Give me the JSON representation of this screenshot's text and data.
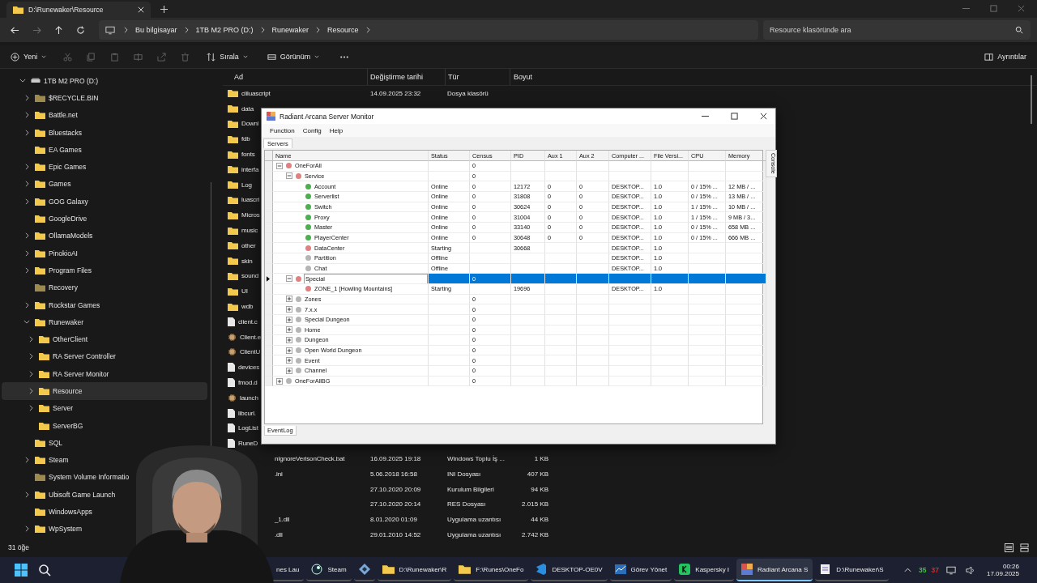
{
  "explorer": {
    "tab_title": "D:\\Runewaker\\Resource",
    "breadcrumb": [
      "Bu bilgisayar",
      "1TB M2 PRO (D:)",
      "Runewaker",
      "Resource"
    ],
    "search": {
      "placeholder": "Resource klasöründe ara"
    },
    "toolbar": {
      "new": "Yeni",
      "sort": "Sırala",
      "view": "Görünüm",
      "details": "Ayrıntılar"
    },
    "status": "31 öğe"
  },
  "sidebar": {
    "items": [
      {
        "label": "1TB M2 PRO (D:)",
        "kind": "drive",
        "expandable": true,
        "expanded": true,
        "hidden": false,
        "selected": false,
        "children": [
          {
            "label": "$RECYCLE.BIN",
            "kind": "folder",
            "expandable": true,
            "expanded": false,
            "hidden": true,
            "selected": false
          },
          {
            "label": "Battle.net",
            "kind": "folder",
            "expandable": true,
            "expanded": false,
            "hidden": false,
            "selected": false
          },
          {
            "label": "Bluestacks",
            "kind": "folder",
            "expandable": true,
            "expanded": false,
            "hidden": false,
            "selected": false
          },
          {
            "label": "EA Games",
            "kind": "folder",
            "expandable": false,
            "expanded": false,
            "hidden": false,
            "selected": false
          },
          {
            "label": "Epic Games",
            "kind": "folder",
            "expandable": true,
            "expanded": false,
            "hidden": false,
            "selected": false
          },
          {
            "label": "Games",
            "kind": "folder",
            "expandable": true,
            "expanded": false,
            "hidden": false,
            "selected": false
          },
          {
            "label": "GOG Galaxy",
            "kind": "folder",
            "expandable": true,
            "expanded": false,
            "hidden": false,
            "selected": false
          },
          {
            "label": "GoogleDrive",
            "kind": "folder",
            "expandable": false,
            "expanded": false,
            "hidden": false,
            "selected": false
          },
          {
            "label": "OllamaModels",
            "kind": "folder",
            "expandable": true,
            "expanded": false,
            "hidden": false,
            "selected": false
          },
          {
            "label": "PinokioAI",
            "kind": "folder",
            "expandable": true,
            "expanded": false,
            "hidden": false,
            "selected": false
          },
          {
            "label": "Program Files",
            "kind": "folder",
            "expandable": true,
            "expanded": false,
            "hidden": false,
            "selected": false
          },
          {
            "label": "Recovery",
            "kind": "folder",
            "expandable": false,
            "expanded": false,
            "hidden": true,
            "selected": false
          },
          {
            "label": "Rockstar Games",
            "kind": "folder",
            "expandable": true,
            "expanded": false,
            "hidden": false,
            "selected": false
          },
          {
            "label": "Runewaker",
            "kind": "folder",
            "expandable": true,
            "expanded": true,
            "hidden": false,
            "selected": false,
            "children": [
              {
                "label": "OtherClient",
                "kind": "folder",
                "expandable": true,
                "expanded": false,
                "hidden": false,
                "selected": false
              },
              {
                "label": "RA Server Controller",
                "kind": "folder",
                "expandable": true,
                "expanded": false,
                "hidden": false,
                "selected": false
              },
              {
                "label": "RA Server Monitor",
                "kind": "folder",
                "expandable": true,
                "expanded": false,
                "hidden": false,
                "selected": false
              },
              {
                "label": "Resource",
                "kind": "folder",
                "expandable": true,
                "expanded": false,
                "hidden": false,
                "selected": true
              },
              {
                "label": "Server",
                "kind": "folder",
                "expandable": true,
                "expanded": false,
                "hidden": false,
                "selected": false
              },
              {
                "label": "ServerBG",
                "kind": "folder",
                "expandable": false,
                "expanded": false,
                "hidden": false,
                "selected": false
              }
            ]
          },
          {
            "label": "SQL",
            "kind": "folder",
            "expandable": false,
            "expanded": false,
            "hidden": false,
            "selected": false
          },
          {
            "label": "Steam",
            "kind": "folder",
            "expandable": true,
            "expanded": false,
            "hidden": false,
            "selected": false
          },
          {
            "label": "System Volume Informatio",
            "kind": "folder",
            "expandable": false,
            "expanded": false,
            "hidden": true,
            "selected": false
          },
          {
            "label": "Ubisoft Game Launch",
            "kind": "folder",
            "expandable": true,
            "expanded": false,
            "hidden": false,
            "selected": false
          },
          {
            "label": "WindowsApps",
            "kind": "folder",
            "expandable": false,
            "expanded": false,
            "hidden": false,
            "selected": false
          },
          {
            "label": "WpSystem",
            "kind": "folder",
            "expandable": true,
            "expanded": false,
            "hidden": false,
            "selected": false
          }
        ]
      }
    ]
  },
  "files": {
    "columns": [
      "Ad",
      "Değiştirme tarihi",
      "Tür",
      "Boyut"
    ],
    "rows": [
      {
        "kind": "folder",
        "name": "cliluascript",
        "modified": "14.09.2025 23:32",
        "type": "Dosya klasörü"
      },
      {
        "kind": "folder",
        "name": "data"
      },
      {
        "kind": "folder",
        "name": "Downl"
      },
      {
        "kind": "folder",
        "name": "fdb"
      },
      {
        "kind": "folder",
        "name": "fonts"
      },
      {
        "kind": "folder",
        "name": "interfa"
      },
      {
        "kind": "folder",
        "name": "Log"
      },
      {
        "kind": "folder",
        "name": "luascri"
      },
      {
        "kind": "folder",
        "name": "Micros"
      },
      {
        "kind": "folder",
        "name": "music"
      },
      {
        "kind": "folder",
        "name": "other"
      },
      {
        "kind": "folder",
        "name": "skin"
      },
      {
        "kind": "folder",
        "name": "sound"
      },
      {
        "kind": "folder",
        "name": "UI"
      },
      {
        "kind": "folder",
        "name": "wdb"
      },
      {
        "kind": "file",
        "name": "client.c"
      },
      {
        "kind": "app",
        "name": "Client.e"
      },
      {
        "kind": "app",
        "name": "ClientU"
      },
      {
        "kind": "file",
        "name": "devices"
      },
      {
        "kind": "file",
        "name": "fmod.d"
      },
      {
        "kind": "app",
        "name": "launch"
      },
      {
        "kind": "file",
        "name": "libcurl."
      },
      {
        "kind": "file",
        "name": "LogList"
      },
      {
        "kind": "file",
        "name": "RuneD"
      },
      {
        "kind": "blank",
        "name": "nIgnoreVerisonCheck.bat",
        "modified": "16.09.2025 19:18",
        "type": "Windows Toplu İş ...",
        "size": "1 KB"
      },
      {
        "kind": "blank",
        "name": ".ini",
        "modified": "5.06.2018 16:58",
        "type": "INI Dosyası",
        "size": "407 KB"
      },
      {
        "kind": "blank",
        "modified": "27.10.2020 20:09",
        "type": "Kurulum Bilgileri",
        "size": "94 KB"
      },
      {
        "kind": "blank",
        "modified": "27.10.2020 20:14",
        "type": "RES Dosyası",
        "size": "2.015 KB"
      },
      {
        "kind": "blank",
        "name": "_1.dll",
        "modified": "8.01.2020 01:09",
        "type": "Uygulama uzantısı",
        "size": "44 KB"
      },
      {
        "kind": "blank",
        "name": ".dll",
        "modified": "29.01.2010 14:52",
        "type": "Uygulama uzantısı",
        "size": "2.742 KB"
      }
    ]
  },
  "monitor": {
    "title": "Radiant Arcana Server Monitor",
    "menu": [
      "Function",
      "Config",
      "Help"
    ],
    "tabs": [
      {
        "label": "Servers",
        "selected": true
      }
    ],
    "side_tab": "Console",
    "bottom_tab": "EventLog",
    "columns": [
      "Name",
      "Status",
      "Census",
      "PID",
      "Aux 1",
      "Aux 2",
      "Computer ...",
      "File Versi...",
      "CPU",
      "Memory"
    ],
    "rows": [
      {
        "name": "OneForAll",
        "color": "#e08080",
        "census": "0",
        "expanded": true,
        "selected": false,
        "children": [
          {
            "name": "Service",
            "color": "#e08080",
            "census": "0",
            "expanded": true,
            "selected": false,
            "children": [
              {
                "name": "Account",
                "color": "#4caf50",
                "status": "Online",
                "census": "0",
                "pid": "12172",
                "aux1": "0",
                "aux2": "0",
                "computer": "DESKTOP...",
                "file_version": "1.0",
                "cpu": "0 / 15% ...",
                "memory": "12 MB / ...",
                "selected": false
              },
              {
                "name": "Serverlist",
                "color": "#4caf50",
                "status": "Online",
                "census": "0",
                "pid": "31808",
                "aux1": "0",
                "aux2": "0",
                "computer": "DESKTOP...",
                "file_version": "1.0",
                "cpu": "0 / 15% ...",
                "memory": "13 MB / ...",
                "selected": false
              },
              {
                "name": "Switch",
                "color": "#4caf50",
                "status": "Online",
                "census": "0",
                "pid": "30624",
                "aux1": "0",
                "aux2": "0",
                "computer": "DESKTOP...",
                "file_version": "1.0",
                "cpu": "1 / 15% ...",
                "memory": "10 MB / ...",
                "selected": false
              },
              {
                "name": "Proxy",
                "color": "#4caf50",
                "status": "Online",
                "census": "0",
                "pid": "31004",
                "aux1": "0",
                "aux2": "0",
                "computer": "DESKTOP...",
                "file_version": "1.0",
                "cpu": "1 / 15% ...",
                "memory": "9 MB / 3...",
                "selected": false
              },
              {
                "name": "Master",
                "color": "#4caf50",
                "status": "Online",
                "census": "0",
                "pid": "33140",
                "aux1": "0",
                "aux2": "0",
                "computer": "DESKTOP...",
                "file_version": "1.0",
                "cpu": "0 / 15% ...",
                "memory": "658 MB ...",
                "selected": false
              },
              {
                "name": "PlayerCenter",
                "color": "#4caf50",
                "status": "Online",
                "census": "0",
                "pid": "30648",
                "aux1": "0",
                "aux2": "0",
                "computer": "DESKTOP...",
                "file_version": "1.0",
                "cpu": "0 / 15% ...",
                "memory": "666 MB ...",
                "selected": false
              },
              {
                "name": "DataCenter",
                "color": "#e08080",
                "status": "Starting",
                "pid": "30668",
                "computer": "DESKTOP...",
                "file_version": "1.0",
                "selected": false
              },
              {
                "name": "Partition",
                "color": "#b5b5b5",
                "status": "Offline",
                "computer": "DESKTOP...",
                "file_version": "1.0",
                "selected": false
              },
              {
                "name": "Chat",
                "color": "#b5b5b5",
                "status": "Offline",
                "computer": "DESKTOP...",
                "file_version": "1.0",
                "selected": false
              }
            ]
          },
          {
            "name": "Special",
            "color": "#e08080",
            "census": "0",
            "expanded": true,
            "selected": true,
            "children": [
              {
                "name": "ZONE_1 [Howling Mountains]",
                "color": "#e08080",
                "status": "Starting",
                "pid": "19696",
                "computer": "DESKTOP...",
                "file_version": "1.0",
                "selected": false
              }
            ]
          },
          {
            "name": "Zones",
            "color": "#b5b5b5",
            "census": "0",
            "expanded": false,
            "selected": false
          },
          {
            "name": "7.x.x",
            "color": "#b5b5b5",
            "census": "0",
            "expanded": false,
            "selected": false
          },
          {
            "name": "Special Dungeon",
            "color": "#b5b5b5",
            "census": "0",
            "expanded": false,
            "selected": false
          },
          {
            "name": "Home",
            "color": "#b5b5b5",
            "census": "0",
            "expanded": false,
            "selected": false
          },
          {
            "name": "Dungeon",
            "color": "#b5b5b5",
            "census": "0",
            "expanded": false,
            "selected": false
          },
          {
            "name": "Open World Dungeon",
            "color": "#b5b5b5",
            "census": "0",
            "expanded": false,
            "selected": false
          },
          {
            "name": "Event",
            "color": "#b5b5b5",
            "census": "0",
            "expanded": false,
            "selected": false
          },
          {
            "name": "Channel",
            "color": "#b5b5b5",
            "census": "0",
            "expanded": false,
            "selected": false
          }
        ]
      },
      {
        "name": "OneForAllBG",
        "color": "#b5b5b5",
        "census": "0",
        "expanded": false,
        "selected": false
      }
    ]
  },
  "taskbar": {
    "items": [
      {
        "kind": "none",
        "label": "nes Lau",
        "active": false
      },
      {
        "kind": "steam",
        "label": "Steam",
        "active": false
      },
      {
        "kind": "diamond",
        "active": false
      },
      {
        "kind": "folder",
        "label": "D:\\Runewaker\\R",
        "active": false
      },
      {
        "kind": "folder",
        "label": "F:\\Runes\\OneFo",
        "active": false
      },
      {
        "kind": "ribbon",
        "label": "DESKTOP-OE0V",
        "active": false
      },
      {
        "kind": "chart",
        "label": "Görev Yönet",
        "active": false
      },
      {
        "kind": "shield",
        "label": "Kaspersky I",
        "active": false
      },
      {
        "kind": "app",
        "label": "Radiant Arcana S",
        "active": true
      },
      {
        "kind": "notepad",
        "label": "D:\\Runewaker\\S",
        "active": false
      }
    ],
    "counters": [
      {
        "text": "35",
        "color": "#3ec43e"
      },
      {
        "text": "37",
        "color": "#d62b2b"
      }
    ],
    "time": "00:26",
    "date": "17.09.2025"
  }
}
